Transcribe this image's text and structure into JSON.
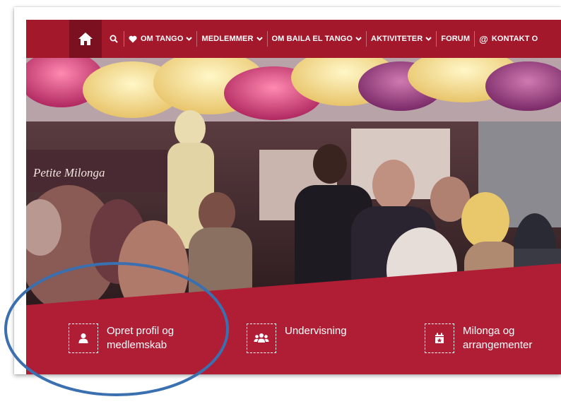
{
  "nav": {
    "items": [
      {
        "label": "OM TANGO",
        "icon": "heart-icon",
        "has_caret": true
      },
      {
        "label": "MEDLEMMER",
        "has_caret": true
      },
      {
        "label": "OM BAILA EL TANGO",
        "has_caret": true
      },
      {
        "label": "AKTIVITETER",
        "has_caret": true
      },
      {
        "label": "FORUM",
        "has_caret": false
      },
      {
        "label": "KONTAKT O",
        "icon": "at-icon",
        "has_caret": false
      }
    ]
  },
  "hero": {
    "sign_text": "Petite Milonga"
  },
  "features": [
    {
      "line1": "Opret profil og",
      "line2": "medlemskab",
      "icon": "user-icon"
    },
    {
      "line1": "Undervisning",
      "line2": "",
      "icon": "users-icon"
    },
    {
      "line1": "Milonga og",
      "line2": "arrangementer",
      "icon": "calendar-icon"
    }
  ],
  "colors": {
    "brand": "#a3182b",
    "brand_dark": "#7a1020",
    "annotation": "#3a6fb0"
  }
}
